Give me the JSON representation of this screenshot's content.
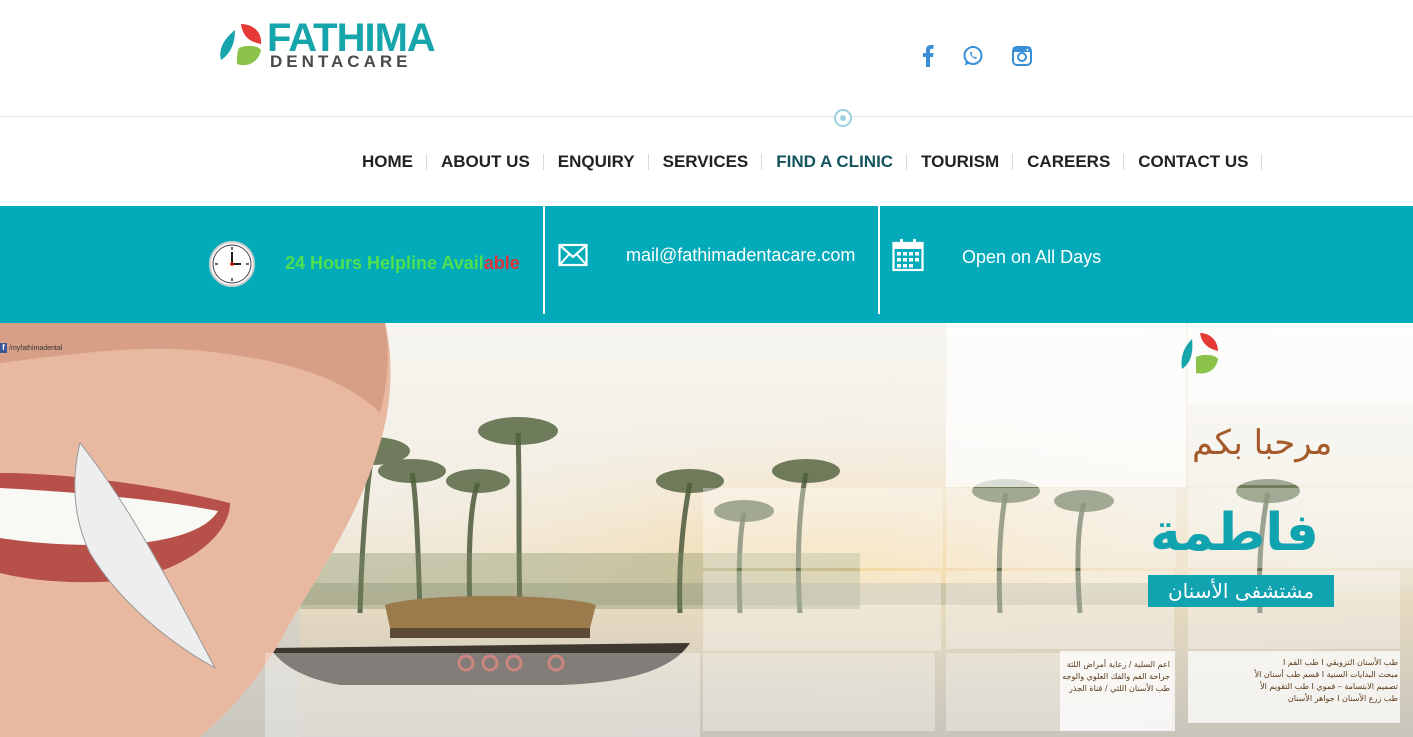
{
  "brand": {
    "name_top": "FATHIMA",
    "name_bottom": "DENTACARE",
    "colors": {
      "teal": "#17a5ac",
      "red": "#e53935",
      "green": "#8bc34a",
      "dark": "#4a4a4a"
    }
  },
  "social": [
    {
      "icon": "facebook-icon",
      "color": "#3b8fd6"
    },
    {
      "icon": "whatsapp-icon",
      "color": "#3b8fd6"
    },
    {
      "icon": "instagram-icon",
      "color": "#3b8fd6"
    }
  ],
  "nav": {
    "items": [
      {
        "label": "HOME"
      },
      {
        "label": "ABOUT US"
      },
      {
        "label": "ENQUIRY"
      },
      {
        "label": "SERVICES"
      },
      {
        "label": "FIND A CLINIC",
        "active": true
      },
      {
        "label": "TOURISM"
      },
      {
        "label": "CAREERS"
      },
      {
        "label": "CONTACT US"
      }
    ]
  },
  "infobar": {
    "color": "#03aab9",
    "helpline_part1": "24 Hours Helpline Avail",
    "helpline_part2": "able",
    "email": "mail@fathimadentacare.com",
    "open": "Open on All Days",
    "icons": [
      "clock-icon",
      "mail-icon",
      "calendar-icon"
    ]
  },
  "banner": {
    "fb_handle": "/myfathimadental",
    "ar_welcome": "مرحبا بكم",
    "ar_name": "فاطمة",
    "ar_hospital": "مشتشفى الأسنان",
    "ar_services_left": [
      "اعم السلية / رعاية أمراض اللثة",
      "جراحة الفم والفك العلوي والوجه",
      "طب الأسنان اللثي / قناة الجذر"
    ],
    "ar_services_right": [
      "طب الأسنان التزويقي I طب الفم I",
      "مبحث البدايات السنية I قسم طب أسنان الأ",
      "تصميم الابتسامة – فموي I طب التقويم الأ",
      "طب زرع الأسنان I جواهر الأسنان"
    ]
  }
}
